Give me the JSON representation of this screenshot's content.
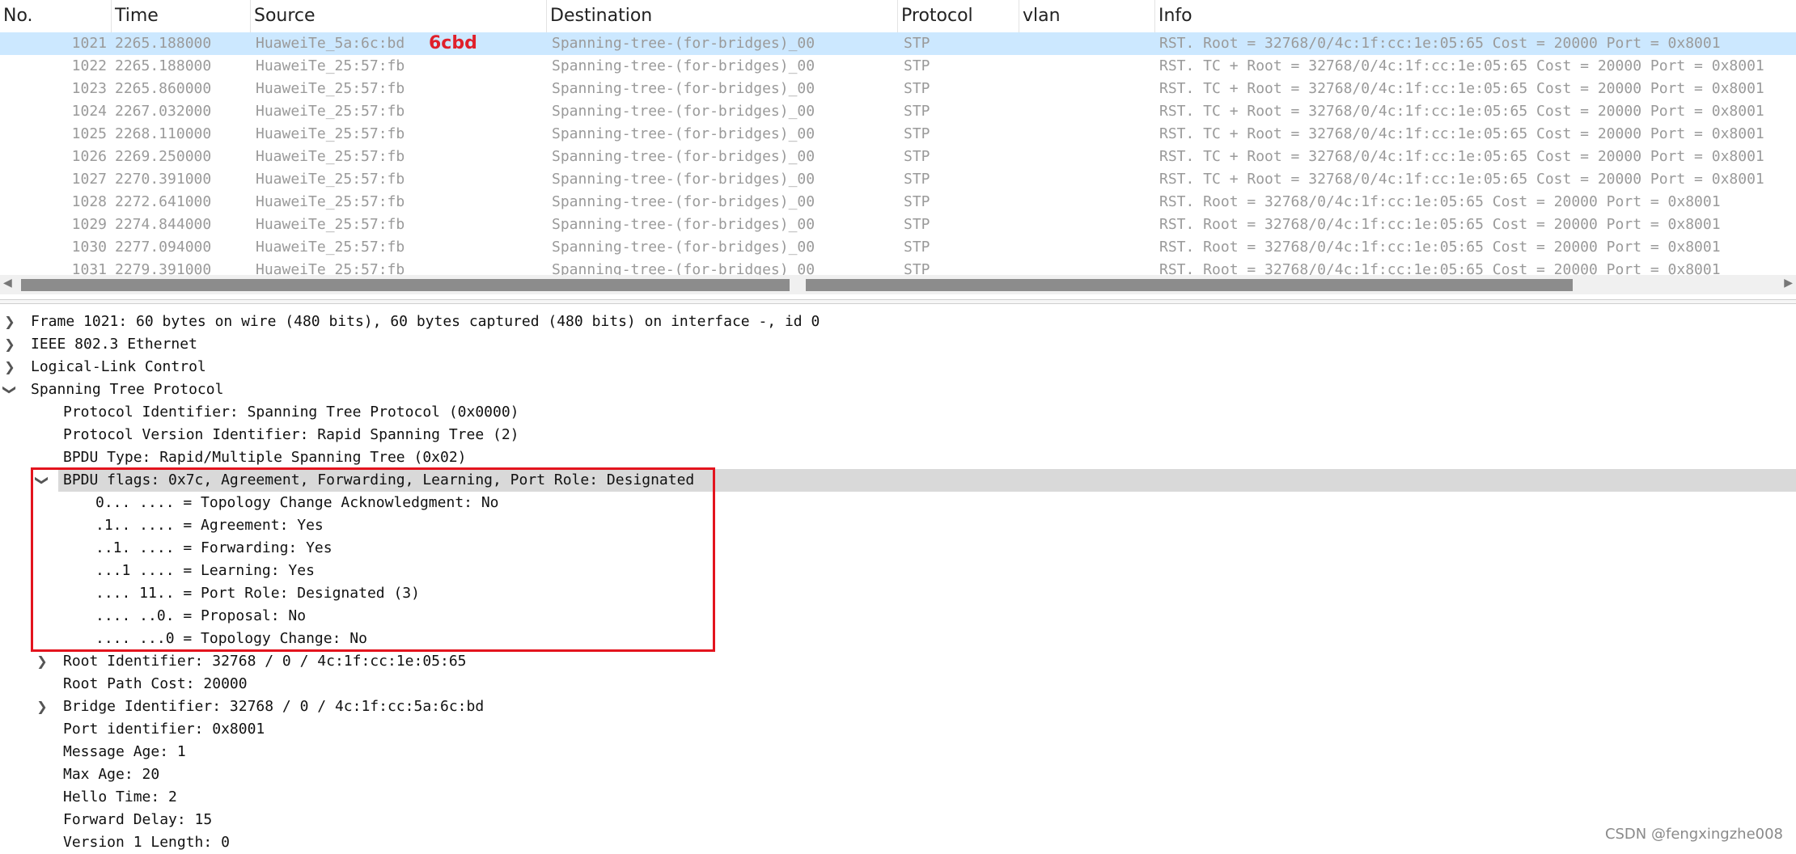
{
  "columns": [
    "No.",
    "Time",
    "Source",
    "Destination",
    "Protocol",
    "vlan",
    "Info"
  ],
  "annotation": "6cbd",
  "packets": [
    {
      "no": "1021",
      "time": "2265.188000",
      "source": "HuaweiTe_5a:6c:bd",
      "destination": "Spanning-tree-(for-bridges)_00",
      "protocol": "STP",
      "info": "RST. Root = 32768/0/4c:1f:cc:1e:05:65  Cost = 20000  Port = 0x8001"
    },
    {
      "no": "1022",
      "time": "2265.188000",
      "source": "HuaweiTe_25:57:fb",
      "destination": "Spanning-tree-(for-bridges)_00",
      "protocol": "STP",
      "info": "RST. TC + Root = 32768/0/4c:1f:cc:1e:05:65  Cost = 20000  Port = 0x8001"
    },
    {
      "no": "1023",
      "time": "2265.860000",
      "source": "HuaweiTe_25:57:fb",
      "destination": "Spanning-tree-(for-bridges)_00",
      "protocol": "STP",
      "info": "RST. TC + Root = 32768/0/4c:1f:cc:1e:05:65  Cost = 20000  Port = 0x8001"
    },
    {
      "no": "1024",
      "time": "2267.032000",
      "source": "HuaweiTe_25:57:fb",
      "destination": "Spanning-tree-(for-bridges)_00",
      "protocol": "STP",
      "info": "RST. TC + Root = 32768/0/4c:1f:cc:1e:05:65  Cost = 20000  Port = 0x8001"
    },
    {
      "no": "1025",
      "time": "2268.110000",
      "source": "HuaweiTe_25:57:fb",
      "destination": "Spanning-tree-(for-bridges)_00",
      "protocol": "STP",
      "info": "RST. TC + Root = 32768/0/4c:1f:cc:1e:05:65  Cost = 20000  Port = 0x8001"
    },
    {
      "no": "1026",
      "time": "2269.250000",
      "source": "HuaweiTe_25:57:fb",
      "destination": "Spanning-tree-(for-bridges)_00",
      "protocol": "STP",
      "info": "RST. TC + Root = 32768/0/4c:1f:cc:1e:05:65  Cost = 20000  Port = 0x8001"
    },
    {
      "no": "1027",
      "time": "2270.391000",
      "source": "HuaweiTe_25:57:fb",
      "destination": "Spanning-tree-(for-bridges)_00",
      "protocol": "STP",
      "info": "RST. TC + Root = 32768/0/4c:1f:cc:1e:05:65  Cost = 20000  Port = 0x8001"
    },
    {
      "no": "1028",
      "time": "2272.641000",
      "source": "HuaweiTe_25:57:fb",
      "destination": "Spanning-tree-(for-bridges)_00",
      "protocol": "STP",
      "info": "RST. Root = 32768/0/4c:1f:cc:1e:05:65  Cost = 20000  Port = 0x8001"
    },
    {
      "no": "1029",
      "time": "2274.844000",
      "source": "HuaweiTe_25:57:fb",
      "destination": "Spanning-tree-(for-bridges)_00",
      "protocol": "STP",
      "info": "RST. Root = 32768/0/4c:1f:cc:1e:05:65  Cost = 20000  Port = 0x8001"
    },
    {
      "no": "1030",
      "time": "2277.094000",
      "source": "HuaweiTe_25:57:fb",
      "destination": "Spanning-tree-(for-bridges)_00",
      "protocol": "STP",
      "info": "RST. Root = 32768/0/4c:1f:cc:1e:05:65  Cost = 20000  Port = 0x8001"
    },
    {
      "no": "1031",
      "time": "2279.391000",
      "source": "HuaweiTe_25:57:fb",
      "destination": "Spanning-tree-(for-bridges)_00",
      "protocol": "STP",
      "info": "RST. Root = 32768/0/4c:1f:cc:1e:05:65  Cost = 20000  Port = 0x8001"
    }
  ],
  "selected_packet_index": 0,
  "details": [
    {
      "depth": 0,
      "toggle": "collapsed",
      "text": "Frame 1021: 60 bytes on wire (480 bits), 60 bytes captured (480 bits) on interface -, id 0"
    },
    {
      "depth": 0,
      "toggle": "collapsed",
      "text": "IEEE 802.3 Ethernet"
    },
    {
      "depth": 0,
      "toggle": "collapsed",
      "text": "Logical-Link Control"
    },
    {
      "depth": 0,
      "toggle": "expanded",
      "text": "Spanning Tree Protocol"
    },
    {
      "depth": 1,
      "toggle": "none",
      "text": "Protocol Identifier: Spanning Tree Protocol (0x0000)"
    },
    {
      "depth": 1,
      "toggle": "none",
      "text": "Protocol Version Identifier: Rapid Spanning Tree (2)"
    },
    {
      "depth": 1,
      "toggle": "none",
      "text": "BPDU Type: Rapid/Multiple Spanning Tree (0x02)"
    },
    {
      "depth": 1,
      "toggle": "expanded",
      "highlight": true,
      "text": "BPDU flags: 0x7c, Agreement, Forwarding, Learning, Port Role: Designated"
    },
    {
      "depth": 2,
      "toggle": "none",
      "text": "0... .... = Topology Change Acknowledgment: No"
    },
    {
      "depth": 2,
      "toggle": "none",
      "text": ".1.. .... = Agreement: Yes"
    },
    {
      "depth": 2,
      "toggle": "none",
      "text": "..1. .... = Forwarding: Yes"
    },
    {
      "depth": 2,
      "toggle": "none",
      "text": "...1 .... = Learning: Yes"
    },
    {
      "depth": 2,
      "toggle": "none",
      "text": ".... 11.. = Port Role: Designated (3)"
    },
    {
      "depth": 2,
      "toggle": "none",
      "text": ".... ..0. = Proposal: No"
    },
    {
      "depth": 2,
      "toggle": "none",
      "text": ".... ...0 = Topology Change: No"
    },
    {
      "depth": 1,
      "toggle": "collapsed",
      "text": "Root Identifier: 32768 / 0 / 4c:1f:cc:1e:05:65"
    },
    {
      "depth": 1,
      "toggle": "none",
      "text": "Root Path Cost: 20000"
    },
    {
      "depth": 1,
      "toggle": "collapsed",
      "text": "Bridge Identifier: 32768 / 0 / 4c:1f:cc:5a:6c:bd"
    },
    {
      "depth": 1,
      "toggle": "none",
      "text": "Port identifier: 0x8001"
    },
    {
      "depth": 1,
      "toggle": "none",
      "text": "Message Age: 1"
    },
    {
      "depth": 1,
      "toggle": "none",
      "text": "Max Age: 20"
    },
    {
      "depth": 1,
      "toggle": "none",
      "text": "Hello Time: 2"
    },
    {
      "depth": 1,
      "toggle": "none",
      "text": "Forward Delay: 15"
    },
    {
      "depth": 1,
      "toggle": "none",
      "text": "Version 1 Length: 0"
    }
  ],
  "icons": {
    "collapsed": "chevron-right-icon",
    "expanded": "chevron-down-icon"
  },
  "colors": {
    "selected_row": "#cce8ff",
    "highlight_row": "#d9d9d9",
    "annotation_red": "#e0202a",
    "box_red": "#e3141e"
  },
  "watermark": "CSDN @fengxingzhe008"
}
